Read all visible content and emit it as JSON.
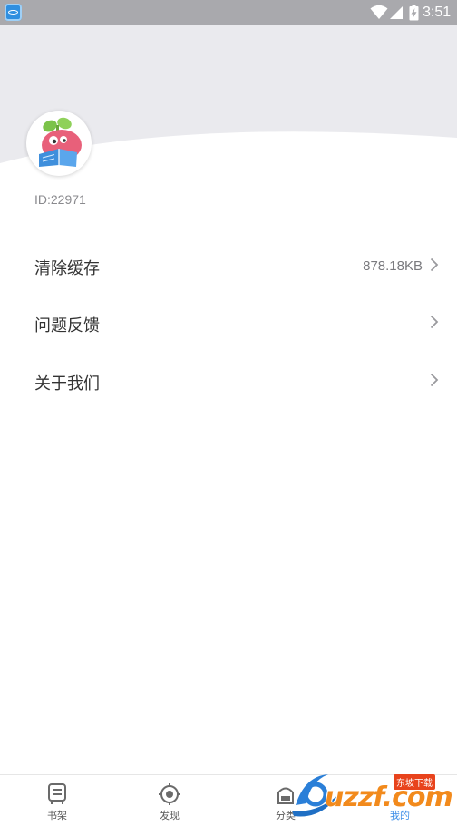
{
  "status_bar": {
    "time": "3:51",
    "icons": [
      "app-icon",
      "wifi-icon",
      "signal-icon",
      "battery-icon"
    ]
  },
  "profile": {
    "user_id": "ID:22971",
    "avatar": "mascot-avatar"
  },
  "menu": [
    {
      "label": "清除缓存",
      "value": "878.18KB",
      "icon": "chevron-right-icon"
    },
    {
      "label": "问题反馈",
      "value": "",
      "icon": "chevron-right-icon"
    },
    {
      "label": "关于我们",
      "value": "",
      "icon": "chevron-right-icon"
    }
  ],
  "bottom_nav": {
    "active_index": 3,
    "items": [
      {
        "label": "书架",
        "icon": "bookshelf-icon"
      },
      {
        "label": "发现",
        "icon": "discover-icon"
      },
      {
        "label": "分类",
        "icon": "category-icon"
      },
      {
        "label": "我的",
        "icon": "profile-icon"
      }
    ]
  },
  "watermark": {
    "text": "uzzf.com",
    "badge": "东坡下载"
  },
  "colors": {
    "status_bar": "#a9a9ad",
    "header_bg": "#eaeaee",
    "accent": "#3c8ee8",
    "text_primary": "#333333",
    "text_secondary": "#7a7a7e"
  }
}
